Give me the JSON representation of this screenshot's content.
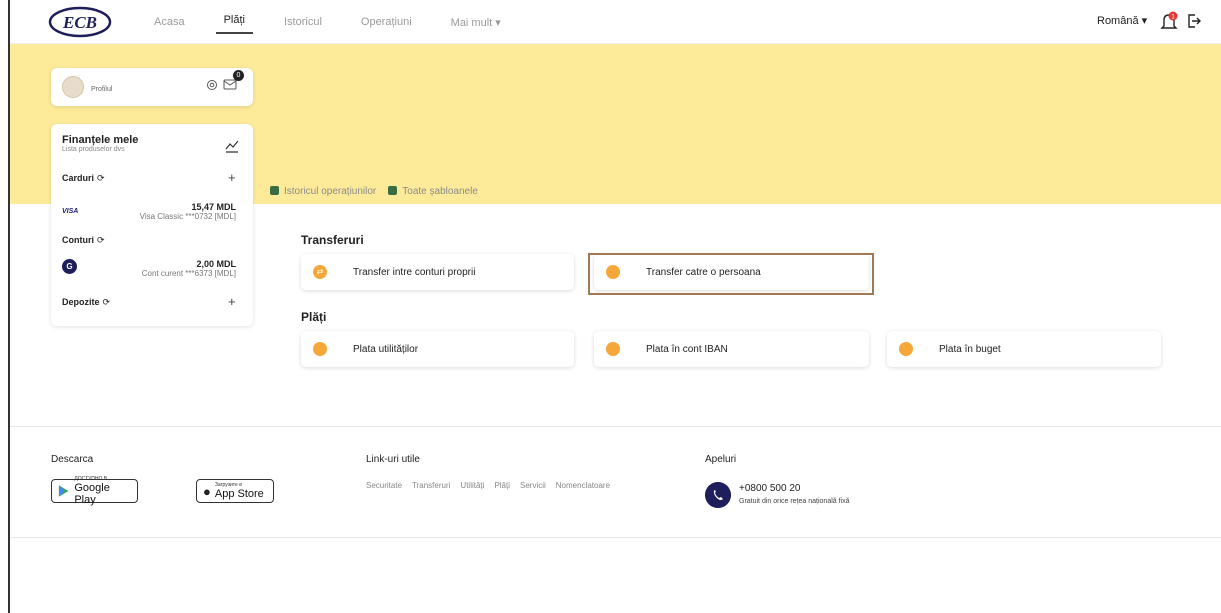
{
  "header": {
    "logo_text": "ECB",
    "nav": [
      "Acasa",
      "Plăți",
      "Istoricul",
      "Operațiuni",
      "Mai mult ▾"
    ],
    "active_nav": "Plăți",
    "language": "Română ▾",
    "notif_count": "1"
  },
  "profile": {
    "label": "Profilul",
    "mail_count": "0"
  },
  "finances": {
    "title": "Finanțele mele",
    "subtitle": "Lista produselor dvs",
    "cards_label": "Carduri",
    "refresh_glyph": "⟳",
    "add_glyph": "+",
    "card": {
      "brand": "VISA",
      "amount": "15,47 MDL",
      "name": "Visa Classic ***0732 [MDL]"
    },
    "accounts_label": "Conturi",
    "account": {
      "amount": "2,00 MDL",
      "name": "Cont curent ***6373 [MDL]"
    },
    "deposits_label": "Depozite"
  },
  "quick_links": [
    "Istoricul operațiunilor",
    "Toate șabloanele"
  ],
  "transfers": {
    "heading": "Transferuri",
    "items": [
      "Transfer intre conturi proprii",
      "Transfer catre o persoana"
    ]
  },
  "payments": {
    "heading": "Plăți",
    "items": [
      "Plata utilităților",
      "Plata în cont IBAN",
      "Plata în buget"
    ]
  },
  "footer": {
    "download_label": "Descarca",
    "google_small": "ДОСТУПНО В",
    "google_big": "Google Play",
    "apple_small": "Загрузите в",
    "apple_big": "App Store",
    "links_label": "Link-uri utile",
    "links": [
      "Securitate",
      "Transferuri",
      "Utilități",
      "Plăți",
      "Servicii",
      "Nomenclatoare"
    ],
    "calls_label": "Apeluri",
    "phone": "+0800 500 20",
    "phone_note": "Gratuit din orice rețea națională fixă"
  },
  "colors": {
    "banner": "#fdeb9a",
    "accent_orange": "#f5a73a",
    "highlight_border": "#a07a57",
    "navy": "#1e1e5a"
  }
}
